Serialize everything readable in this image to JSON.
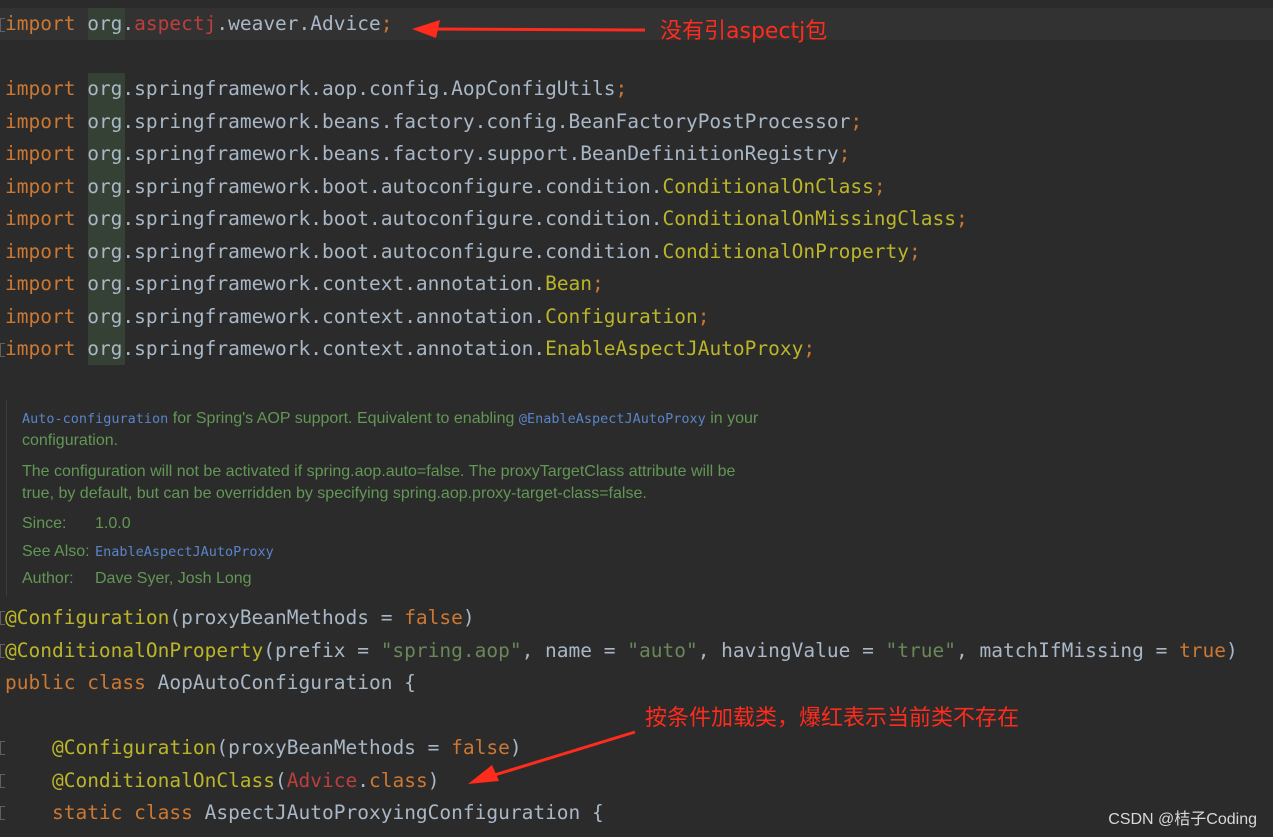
{
  "imports": [
    {
      "kw": "import",
      "prefix": "org.",
      "parts": [
        {
          "t": "aspectj",
          "c": "red"
        },
        {
          "t": ".weaver.",
          "c": "id"
        },
        {
          "t": "Advice",
          "c": "id"
        },
        {
          "t": ";",
          "c": "kw"
        }
      ]
    },
    {
      "kw": "import",
      "prefix": "org.",
      "parts": [
        {
          "t": "springframework.aop.config.AopConfigUtils",
          "c": "id"
        },
        {
          "t": ";",
          "c": "kw"
        }
      ]
    },
    {
      "kw": "import",
      "prefix": "org.",
      "parts": [
        {
          "t": "springframework.beans.factory.config.BeanFactoryPostProcessor",
          "c": "id"
        },
        {
          "t": ";",
          "c": "kw"
        }
      ]
    },
    {
      "kw": "import",
      "prefix": "org.",
      "parts": [
        {
          "t": "springframework.beans.factory.support.BeanDefinitionRegistry",
          "c": "id"
        },
        {
          "t": ";",
          "c": "kw"
        }
      ]
    },
    {
      "kw": "import",
      "prefix": "org.",
      "parts": [
        {
          "t": "springframework.boot.autoconfigure.condition.",
          "c": "id"
        },
        {
          "t": "ConditionalOnClass",
          "c": "ann"
        },
        {
          "t": ";",
          "c": "kw"
        }
      ]
    },
    {
      "kw": "import",
      "prefix": "org.",
      "parts": [
        {
          "t": "springframework.boot.autoconfigure.condition.",
          "c": "id"
        },
        {
          "t": "ConditionalOnMissingClass",
          "c": "ann"
        },
        {
          "t": ";",
          "c": "kw"
        }
      ]
    },
    {
      "kw": "import",
      "prefix": "org.",
      "parts": [
        {
          "t": "springframework.boot.autoconfigure.condition.",
          "c": "id"
        },
        {
          "t": "ConditionalOnProperty",
          "c": "ann"
        },
        {
          "t": ";",
          "c": "kw"
        }
      ]
    },
    {
      "kw": "import",
      "prefix": "org.",
      "parts": [
        {
          "t": "springframework.context.annotation.",
          "c": "id"
        },
        {
          "t": "Bean",
          "c": "ann"
        },
        {
          "t": ";",
          "c": "kw"
        }
      ]
    },
    {
      "kw": "import",
      "prefix": "org.",
      "parts": [
        {
          "t": "springframework.context.annotation.",
          "c": "id"
        },
        {
          "t": "Configuration",
          "c": "ann"
        },
        {
          "t": ";",
          "c": "kw"
        }
      ]
    },
    {
      "kw": "import",
      "prefix": "org.",
      "parts": [
        {
          "t": "springframework.context.annotation.",
          "c": "id"
        },
        {
          "t": "EnableAspectJAutoProxy",
          "c": "ann"
        },
        {
          "t": ";",
          "c": "kw"
        }
      ]
    }
  ],
  "doc": {
    "link1": "Auto-configuration",
    "text1": " for Spring's AOP support. Equivalent to enabling ",
    "link2": "@EnableAspectJAutoProxy",
    "text2": " in your",
    "text3": "configuration.",
    "para2_line1": "The configuration will not be activated if spring.aop.auto=false. The proxyTargetClass attribute will be",
    "para2_line2": "true, by default, but can be overridden by specifying spring.aop.proxy-target-class=false.",
    "since_label": "Since:",
    "since_value": "1.0.0",
    "see_also_label": "See Also:",
    "see_also_value": "EnableAspectJAutoProxy",
    "author_label": "Author:",
    "author_value": "Dave Syer, Josh Long"
  },
  "code": [
    {
      "parts": [
        {
          "t": "@Configuration",
          "c": "ann"
        },
        {
          "t": "(proxyBeanMethods = ",
          "c": "id"
        },
        {
          "t": "false",
          "c": "kw"
        },
        {
          "t": ")",
          "c": "id"
        }
      ]
    },
    {
      "parts": [
        {
          "t": "@ConditionalOnProperty",
          "c": "ann"
        },
        {
          "t": "(prefix = ",
          "c": "id"
        },
        {
          "t": "\"spring.aop\"",
          "c": "str"
        },
        {
          "t": ", name = ",
          "c": "id"
        },
        {
          "t": "\"auto\"",
          "c": "str"
        },
        {
          "t": ", havingValue = ",
          "c": "id"
        },
        {
          "t": "\"true\"",
          "c": "str"
        },
        {
          "t": ", matchIfMissing = ",
          "c": "id"
        },
        {
          "t": "true",
          "c": "kw"
        },
        {
          "t": ")",
          "c": "id"
        }
      ]
    },
    {
      "parts": [
        {
          "t": "public ",
          "c": "kw"
        },
        {
          "t": "class ",
          "c": "kw"
        },
        {
          "t": "AopAutoConfiguration {",
          "c": "id"
        }
      ]
    },
    {
      "parts": [
        {
          "t": "    ",
          "c": "id"
        },
        {
          "t": "@Configuration",
          "c": "ann"
        },
        {
          "t": "(proxyBeanMethods = ",
          "c": "id"
        },
        {
          "t": "false",
          "c": "kw"
        },
        {
          "t": ")",
          "c": "id"
        }
      ]
    },
    {
      "parts": [
        {
          "t": "    ",
          "c": "id"
        },
        {
          "t": "@ConditionalOnClass",
          "c": "ann"
        },
        {
          "t": "(",
          "c": "id"
        },
        {
          "t": "Advice",
          "c": "red"
        },
        {
          "t": ".",
          "c": "id"
        },
        {
          "t": "class",
          "c": "kw"
        },
        {
          "t": ")",
          "c": "id"
        }
      ]
    },
    {
      "parts": [
        {
          "t": "    ",
          "c": "id"
        },
        {
          "t": "static ",
          "c": "kw"
        },
        {
          "t": "class ",
          "c": "kw"
        },
        {
          "t": "AspectJAutoProxyingConfiguration {",
          "c": "id"
        }
      ]
    }
  ],
  "callouts": {
    "top": "没有引aspectj包",
    "bottom": "按条件加载类，爆红表示当前类不存在"
  },
  "watermark": "CSDN @桔子Coding",
  "colors": {
    "background": "#2b2b2b",
    "keyword": "#cc7832",
    "annotation": "#bbb529",
    "string": "#6a8759",
    "error": "#bc3f3c",
    "callout": "#ff2b1c"
  }
}
